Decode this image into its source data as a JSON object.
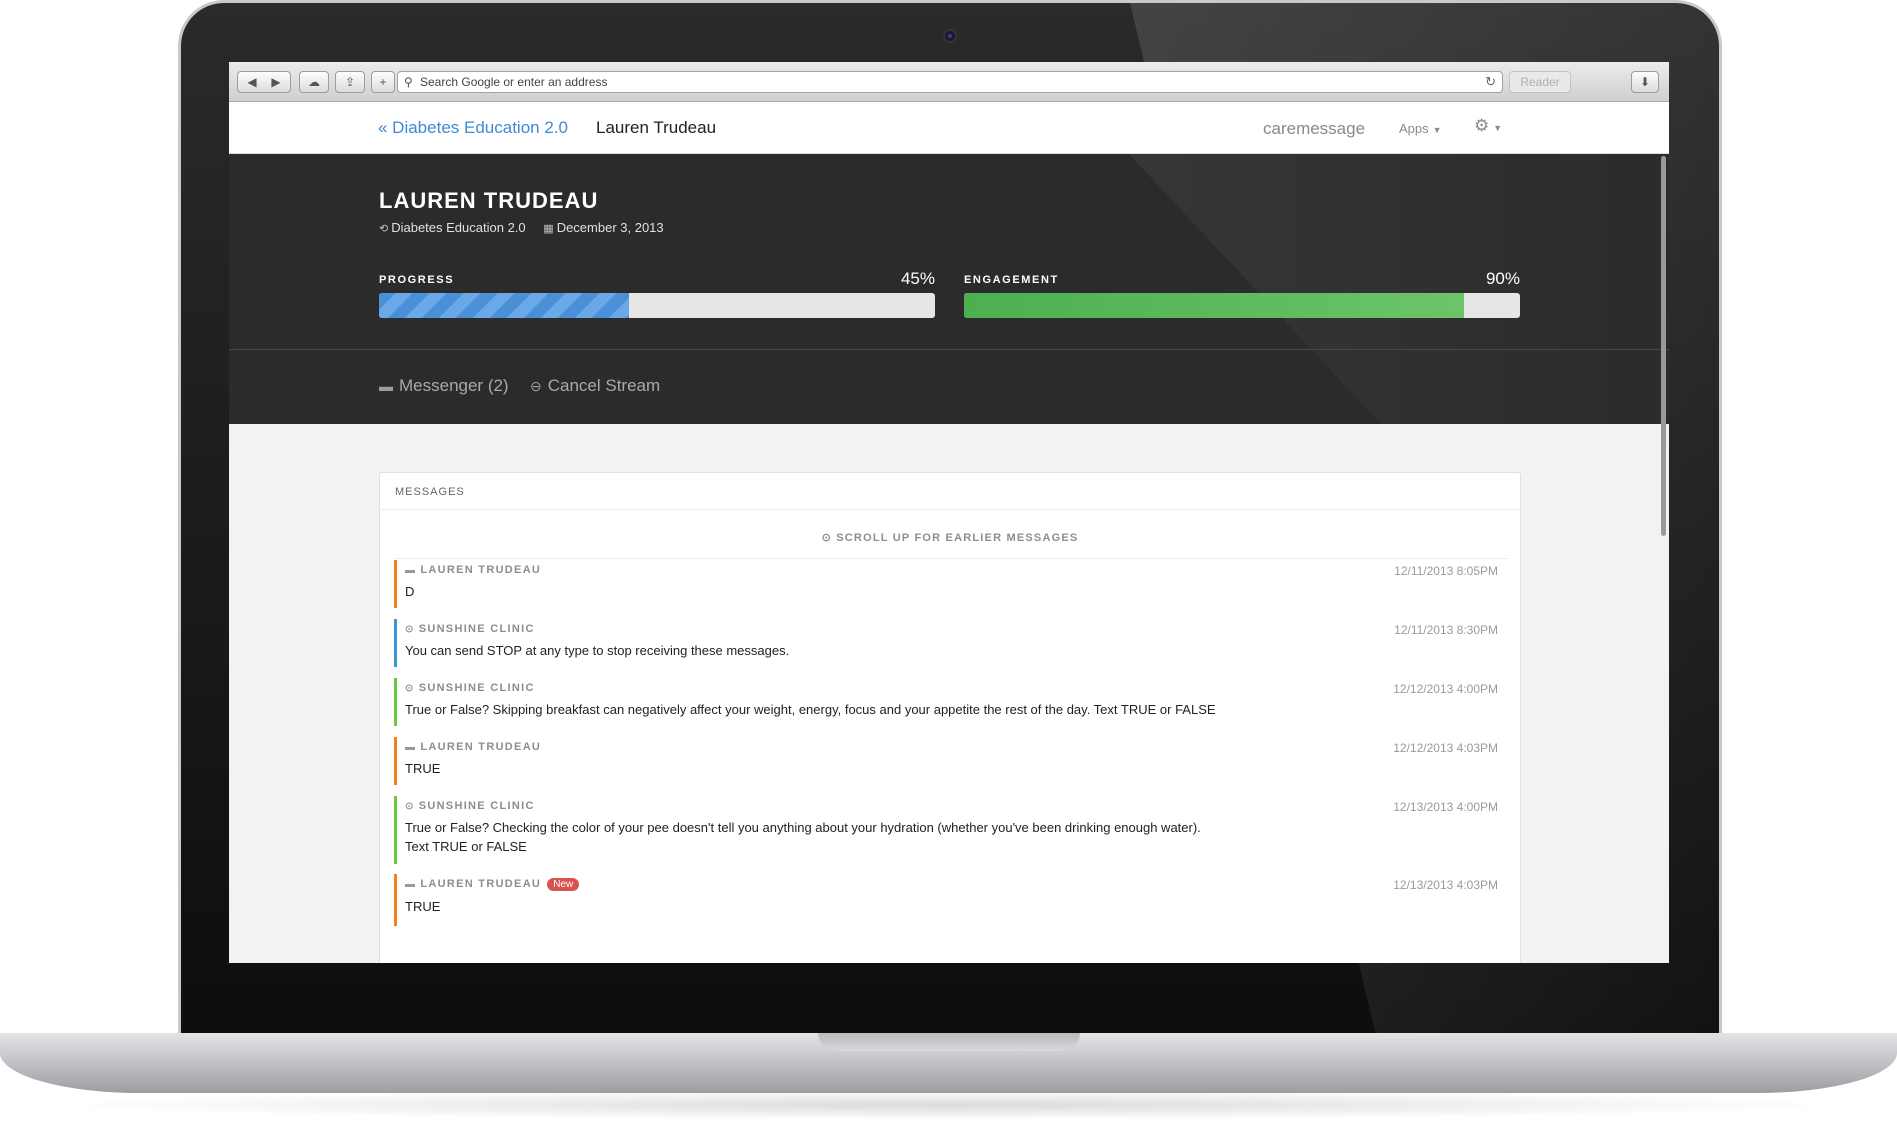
{
  "browser": {
    "address_placeholder": "Search Google or enter an address",
    "reader_label": "Reader"
  },
  "navbar": {
    "back_link": "« Diabetes Education 2.0",
    "current": "Lauren Trudeau",
    "brand": "caremessage",
    "apps_label": "Apps"
  },
  "patient": {
    "name": "LAUREN TRUDEAU",
    "program": "Diabetes Education 2.0",
    "date": "December 3, 2013"
  },
  "stats": {
    "progress": {
      "label": "PROGRESS",
      "value_text": "45%",
      "fraction": 0.45
    },
    "engagement": {
      "label": "ENGAGEMENT",
      "value_text": "90%",
      "fraction": 0.9
    }
  },
  "actions": {
    "messenger": "Messenger (2)",
    "cancel_stream": "Cancel Stream"
  },
  "messages_panel": {
    "title": "MESSAGES",
    "scroll_hint": "SCROLL UP FOR EARLIER MESSAGES",
    "new_badge": "New",
    "items": [
      {
        "sender": "LAUREN TRUDEAU",
        "time": "12/11/2013 8:05PM",
        "text": "D"
      },
      {
        "sender": "SUNSHINE CLINIC",
        "time": "12/11/2013 8:30PM",
        "text": "You can send STOP at any type to stop receiving these messages."
      },
      {
        "sender": "SUNSHINE CLINIC",
        "time": "12/12/2013 4:00PM",
        "text": "True or False? Skipping breakfast can negatively affect your weight, energy, focus and your appetite the rest of the day. Text TRUE or FALSE"
      },
      {
        "sender": "LAUREN TRUDEAU",
        "time": "12/12/2013 4:03PM",
        "text": "TRUE"
      },
      {
        "sender": "SUNSHINE CLINIC",
        "time": "12/13/2013 4:00PM",
        "text": "True or False? Checking the color of your pee doesn't tell you anything about your hydration (whether you've been drinking enough water).",
        "text2": "Text TRUE or FALSE"
      },
      {
        "sender": "LAUREN TRUDEAU",
        "time": "12/13/2013 4:03PM",
        "text": "TRUE"
      }
    ]
  },
  "colors": {
    "link_blue": "#3f8ad1",
    "progress_blue": "#4a90d9",
    "engagement_green": "#4caf50",
    "patient_orange": "#f0821e",
    "clinic_blue": "#3a95d8",
    "clinic_green": "#6cc93f",
    "badge_red": "#d9534f"
  }
}
